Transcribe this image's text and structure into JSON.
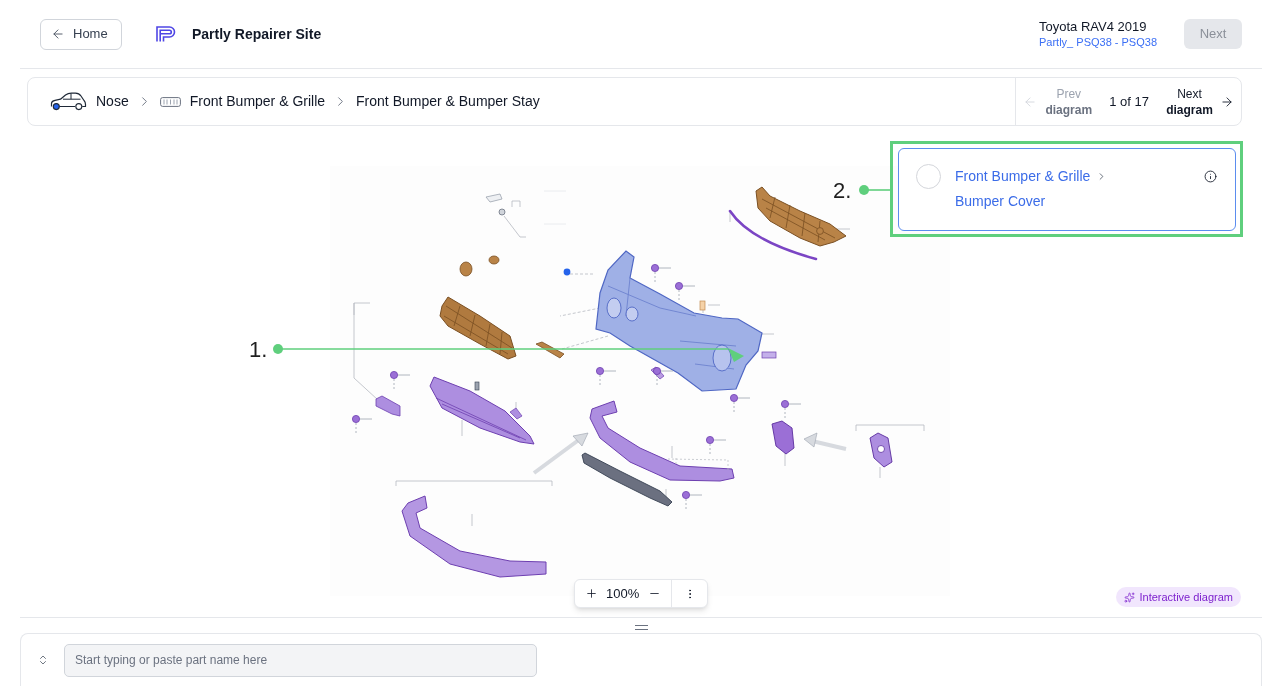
{
  "header": {
    "back_button": "Home",
    "title": "Partly Repairer Site",
    "vehicle": {
      "name": "Toyota RAV4 2019",
      "code": "Partly_ PSQ38 - PSQ38"
    },
    "next_button": {
      "label": "Next",
      "disabled": true
    }
  },
  "breadcrumb": [
    {
      "label": "Nose",
      "kind": "car"
    },
    {
      "label": "Front Bumper & Grille",
      "kind": "grille"
    },
    {
      "label": "Front Bumper & Bumper Stay",
      "kind": "plain"
    }
  ],
  "pager": {
    "prev": {
      "line_1": "Prev",
      "line_2": "diagram",
      "disabled": true
    },
    "position": "1 of 17",
    "next": {
      "line_1": "Next",
      "line_2": "diagram",
      "disabled": false
    }
  },
  "part_card": {
    "category": "Front Bumper & Grille",
    "part": "Bumper Cover",
    "selected": false
  },
  "annotations": [
    {
      "label": "1.",
      "kind": "line"
    },
    {
      "label": "2.",
      "kind": "box"
    }
  ],
  "zoom_toolbar": {
    "zoom": "100%"
  },
  "badge": "Interactive diagram",
  "search": {
    "placeholder": "Start typing or paste part name here"
  }
}
